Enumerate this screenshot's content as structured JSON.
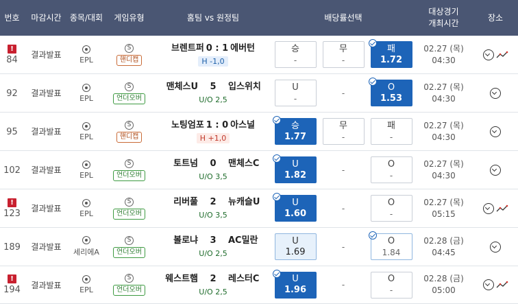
{
  "header": {
    "col_no": "번호",
    "col_deadline": "마감시간",
    "col_league": "종목/대회",
    "col_type": "게임유형",
    "col_teams": "홈팀 vs 원정팀",
    "col_odds": "배당률선택",
    "col_date_l1": "대상경기",
    "col_date_l2": "개최시간",
    "col_place": "장소"
  },
  "colors": {
    "header_bg": "#4a5673",
    "selected_blue": "#1d64b8",
    "alert_red": "#c8202f",
    "handicap_badge": "#c96a36",
    "overunder_badge": "#3c9a40"
  },
  "rows": [
    {
      "no": "84",
      "alert": true,
      "deadline": "결과발표",
      "league": "EPL",
      "type_icon": "S",
      "type": "핸디캡",
      "type_kind": "hd",
      "home": "브렌트퍼",
      "score": "0 : 1",
      "away": "에버턴",
      "tight": true,
      "line": "H -1,0",
      "line_kind": "blue",
      "o1": {
        "label": "승",
        "val": "-",
        "state": "plain"
      },
      "o2": {
        "label": "무",
        "val": "-",
        "state": "plain"
      },
      "o3": {
        "label": "패",
        "val": "1.72",
        "state": "sel"
      },
      "date": "02.27 (목)",
      "time": "04:30",
      "trend": true
    },
    {
      "no": "92",
      "alert": false,
      "deadline": "결과발표",
      "league": "EPL",
      "type_icon": "S",
      "type": "언더오버",
      "type_kind": "uo",
      "home": "맨체스U",
      "score": "5",
      "away": "입스위치",
      "tight": false,
      "line": "U/O 2,5",
      "line_kind": "uo",
      "o1": {
        "label": "U",
        "val": "-",
        "state": "plain"
      },
      "o2": {
        "label": "",
        "val": "-",
        "state": "none"
      },
      "o3": {
        "label": "O",
        "val": "1.53",
        "state": "sel"
      },
      "date": "02.27 (목)",
      "time": "04:30",
      "trend": false
    },
    {
      "no": "95",
      "alert": false,
      "deadline": "결과발표",
      "league": "EPL",
      "type_icon": "S",
      "type": "핸디캡",
      "type_kind": "hd",
      "home": "노팅엄포",
      "score": "1 : 0",
      "away": "아스널",
      "tight": true,
      "line": "H +1,0",
      "line_kind": "red",
      "o1": {
        "label": "승",
        "val": "1.77",
        "state": "sel"
      },
      "o2": {
        "label": "무",
        "val": "-",
        "state": "plain"
      },
      "o3": {
        "label": "패",
        "val": "-",
        "state": "plain"
      },
      "date": "02.27 (목)",
      "time": "04:30",
      "trend": false
    },
    {
      "no": "102",
      "alert": false,
      "deadline": "결과발표",
      "league": "EPL",
      "type_icon": "S",
      "type": "언더오버",
      "type_kind": "uo",
      "home": "토트넘",
      "score": "0",
      "away": "맨체스C",
      "tight": false,
      "line": "U/O 3,5",
      "line_kind": "uo",
      "o1": {
        "label": "U",
        "val": "1.82",
        "state": "sel"
      },
      "o2": {
        "label": "",
        "val": "-",
        "state": "none"
      },
      "o3": {
        "label": "O",
        "val": "-",
        "state": "plain"
      },
      "date": "02.27 (목)",
      "time": "04:30",
      "trend": false
    },
    {
      "no": "123",
      "alert": true,
      "deadline": "결과발표",
      "league": "EPL",
      "type_icon": "S",
      "type": "언더오버",
      "type_kind": "uo",
      "home": "리버풀",
      "score": "2",
      "away": "뉴캐슬U",
      "tight": false,
      "line": "U/O 3,5",
      "line_kind": "uo",
      "o1": {
        "label": "U",
        "val": "1.60",
        "state": "sel"
      },
      "o2": {
        "label": "",
        "val": "-",
        "state": "none"
      },
      "o3": {
        "label": "O",
        "val": "-",
        "state": "plain"
      },
      "date": "02.27 (목)",
      "time": "05:15",
      "trend": true
    },
    {
      "no": "189",
      "alert": false,
      "deadline": "결과발표",
      "league": "세리에A",
      "type_icon": "S",
      "type": "언더오버",
      "type_kind": "uo",
      "home": "볼로냐",
      "score": "3",
      "away": "AC밀란",
      "tight": false,
      "line": "U/O 2,5",
      "line_kind": "uo",
      "o1": {
        "label": "U",
        "val": "1.69",
        "state": "lsel"
      },
      "o2": {
        "label": "",
        "val": "-",
        "state": "none"
      },
      "o3": {
        "label": "O",
        "val": "1.84",
        "state": "outl"
      },
      "date": "02.28 (금)",
      "time": "04:45",
      "trend": false
    },
    {
      "no": "194",
      "alert": true,
      "deadline": "결과발표",
      "league": "EPL",
      "type_icon": "S",
      "type": "언더오버",
      "type_kind": "uo",
      "home": "웨스트햄",
      "score": "2",
      "away": "레스터C",
      "tight": false,
      "line": "U/O 2,5",
      "line_kind": "uo",
      "o1": {
        "label": "U",
        "val": "1.96",
        "state": "sel"
      },
      "o2": {
        "label": "",
        "val": "-",
        "state": "none"
      },
      "o3": {
        "label": "O",
        "val": "-",
        "state": "plain"
      },
      "date": "02.28 (금)",
      "time": "05:00",
      "trend": true
    }
  ]
}
